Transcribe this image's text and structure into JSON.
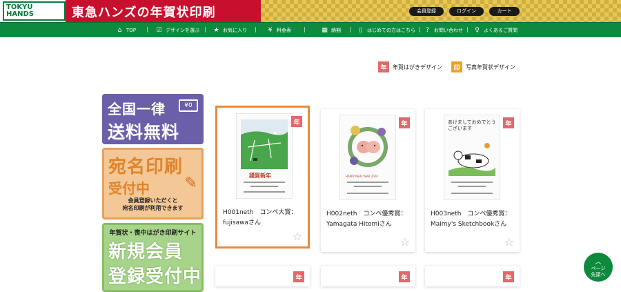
{
  "header": {
    "logo_text": "TOKYU HANDS",
    "title": "東急ハンズの年賀状印刷",
    "account_buttons": [
      "会員登録",
      "ログイン",
      "カート"
    ]
  },
  "nav": {
    "items": [
      {
        "label": "TOP",
        "icon": "home-icon"
      },
      {
        "label": "デザインを選ぶ",
        "icon": "check-icon"
      },
      {
        "label": "お気に入り",
        "icon": "star-icon"
      },
      {
        "label": "料金表",
        "icon": "money-bag-icon"
      },
      {
        "label": "納期",
        "icon": "calendar-icon"
      },
      {
        "label": "はじめての方はこちら",
        "icon": "book-icon"
      },
      {
        "label": "お問い合わせ",
        "icon": "question-icon"
      },
      {
        "label": "よくあるご質問",
        "icon": "faq-icon"
      }
    ]
  },
  "legend": {
    "nenga_badge": "年",
    "nenga_label": "年賀はがきデザイン",
    "photo_badge": "印",
    "photo_label": "写真年賀状デザイン"
  },
  "banners": {
    "free_shipping": {
      "line1": "全国一律",
      "line2": "送料無料",
      "icon_text": "¥0"
    },
    "address_print": {
      "line1": "宛名印刷",
      "line2": "受付中",
      "line3": "会員登録いただくと",
      "line4": "宛名印刷が利用できます"
    },
    "register": {
      "line1": "年賀状・喪中はがき印刷サイト",
      "line2": "新規会員",
      "line3": "登録受付中"
    }
  },
  "cards": [
    {
      "badge": "年",
      "caption": "H001neth　コンペ大賞：fujisawaさん",
      "selected": true
    },
    {
      "badge": "年",
      "caption": "H002neth　コンペ優秀賞：Yamagata Hitomiさん",
      "selected": false
    },
    {
      "badge": "年",
      "caption": "H003neth　コンペ優秀賞：Maimy's Sketchbookさん",
      "selected": false
    }
  ],
  "thumb_text": {
    "card1": "謹賀新年",
    "card2": "HAPPY NEW YEAR 2020",
    "card3": "あけましておめでとうございます"
  },
  "page_top": {
    "line1": "ページ",
    "line2": "先頭へ"
  },
  "colors": {
    "brand_red": "#c8102e",
    "nav_green": "#0e8a3e",
    "nenga_badge": "#e06a6a",
    "photo_badge": "#f0a020",
    "selected_border": "#e8893a"
  }
}
